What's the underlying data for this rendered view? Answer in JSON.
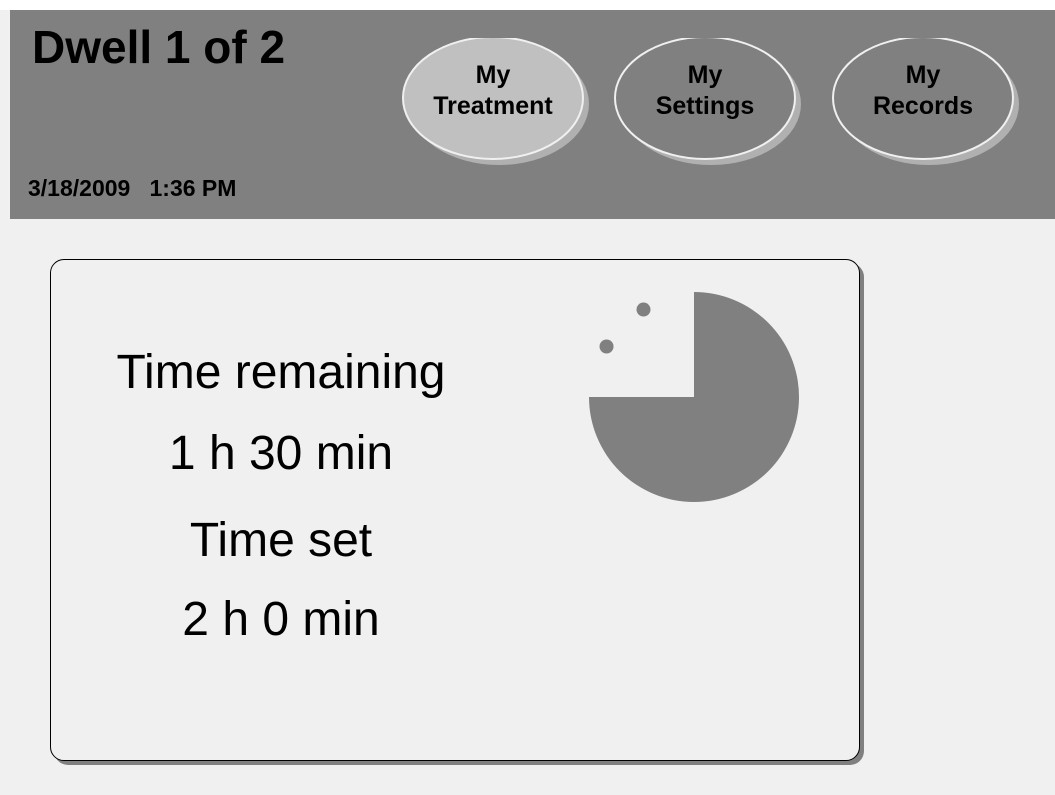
{
  "header": {
    "title": "Dwell 1 of 2",
    "date": "3/18/2009",
    "time": "1:36 PM"
  },
  "tabs": [
    {
      "label": "My\nTreatment",
      "selected": true
    },
    {
      "label": "My\nSettings",
      "selected": false
    },
    {
      "label": "My\nRecords",
      "selected": false
    }
  ],
  "panel": {
    "remaining_label": "Time remaining",
    "remaining_value": "1 h  30 min",
    "set_label": "Time set",
    "set_value": "2 h  0 min"
  },
  "timer": {
    "icon": "pie-timer-icon",
    "remaining_fraction": 0.75,
    "elapsed_dots": 2
  },
  "colors": {
    "header_bg": "#808080",
    "screen_bg": "#f0f0f0",
    "tab_selected": "#c0c0c0",
    "tab_normal": "#808080",
    "timer_fill": "#808080"
  }
}
